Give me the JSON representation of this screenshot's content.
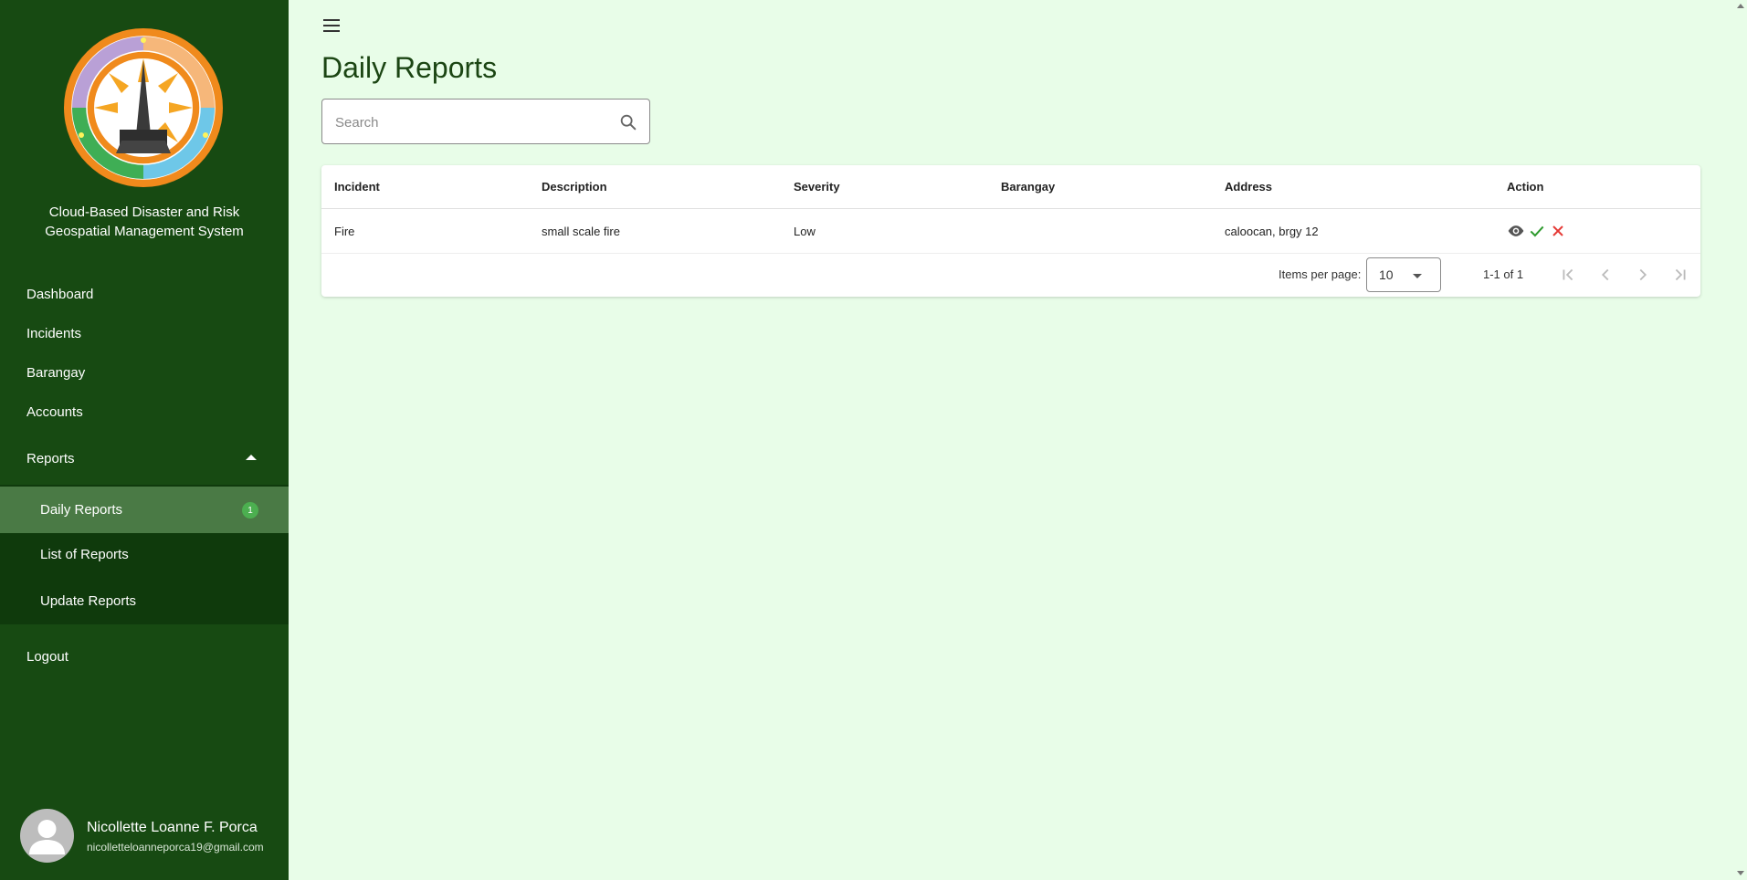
{
  "app": {
    "org_name_line1": "Cloud-Based Disaster and Risk",
    "org_name_line2": "Geospatial Management System",
    "logo_icon": "caloocan-drrm-seal-icon"
  },
  "sidebar": {
    "items": [
      {
        "label": "Dashboard"
      },
      {
        "label": "Incidents"
      },
      {
        "label": "Barangay"
      },
      {
        "label": "Accounts"
      },
      {
        "label": "Reports"
      },
      {
        "label": "Logout"
      }
    ],
    "reports_submenu": [
      {
        "label": "Daily Reports",
        "badge": "1"
      },
      {
        "label": "List of Reports"
      },
      {
        "label": "Update Reports"
      }
    ]
  },
  "user": {
    "name": "Nicollette Loanne F. Porca",
    "email": "nicolletteloanneporca19@gmail.com"
  },
  "main": {
    "title": "Daily Reports",
    "search_placeholder": "Search"
  },
  "table": {
    "columns": [
      "Incident",
      "Description",
      "Severity",
      "Barangay",
      "Address",
      "Action"
    ],
    "rows": [
      {
        "incident": "Fire",
        "description": "small scale fire",
        "severity": "Low",
        "barangay": "",
        "address": "caloocan, brgy 12"
      }
    ],
    "actions": [
      "view-icon",
      "approve-check-icon",
      "reject-x-icon"
    ]
  },
  "paginator": {
    "items_per_page_label": "Items per page:",
    "items_per_page_value": "10",
    "range_label": "1-1 of 1"
  },
  "colors": {
    "sidebar_bg": "#174a12",
    "submenu_bg": "#0f3a0c",
    "active_item_bg": "#4a7a45",
    "page_bg": "#e8fde8",
    "title_color": "#1b4513",
    "approve_color": "#2e9a2e",
    "reject_color": "#e53935",
    "badge_color": "#4caf50"
  }
}
